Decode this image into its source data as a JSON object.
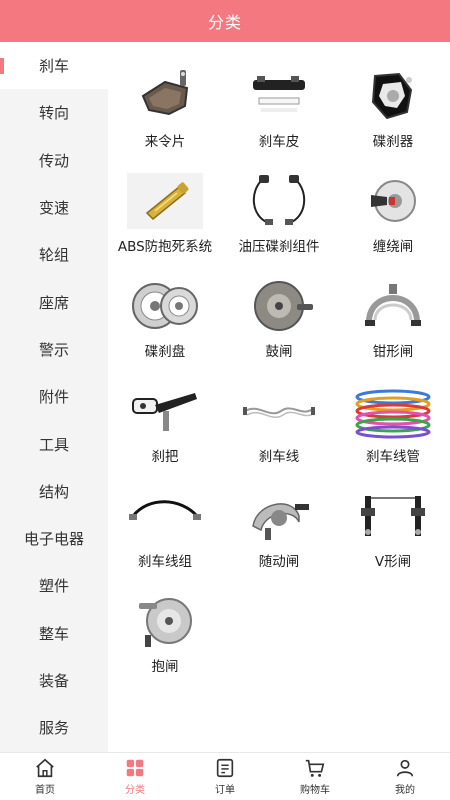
{
  "header": {
    "title": "分类"
  },
  "sidebar": {
    "items": [
      {
        "label": "刹车",
        "active": true
      },
      {
        "label": "转向"
      },
      {
        "label": "传动"
      },
      {
        "label": "变速"
      },
      {
        "label": "轮组"
      },
      {
        "label": "座席"
      },
      {
        "label": "警示"
      },
      {
        "label": "附件"
      },
      {
        "label": "工具"
      },
      {
        "label": "结构"
      },
      {
        "label": "电子电器"
      },
      {
        "label": "塑件"
      },
      {
        "label": "整车"
      },
      {
        "label": "装备"
      },
      {
        "label": "服务"
      }
    ]
  },
  "products": [
    {
      "label": "来令片",
      "icon": "brake-pad-icon"
    },
    {
      "label": "刹车皮",
      "icon": "brake-shoe-icon"
    },
    {
      "label": "碟刹器",
      "icon": "disc-caliper-icon"
    },
    {
      "label": "ABS防抱死系统",
      "icon": "abs-module-icon"
    },
    {
      "label": "油压碟刹组件",
      "icon": "hydraulic-disc-kit-icon"
    },
    {
      "label": "缠绕闸",
      "icon": "band-brake-icon"
    },
    {
      "label": "碟刹盘",
      "icon": "brake-rotor-icon"
    },
    {
      "label": "鼓闸",
      "icon": "drum-brake-icon"
    },
    {
      "label": "钳形闸",
      "icon": "caliper-brake-icon"
    },
    {
      "label": "刹把",
      "icon": "brake-lever-icon"
    },
    {
      "label": "刹车线",
      "icon": "brake-cable-icon"
    },
    {
      "label": "刹车线管",
      "icon": "cable-housing-icon"
    },
    {
      "label": "刹车线组",
      "icon": "cable-set-icon"
    },
    {
      "label": "随动闸",
      "icon": "follow-brake-icon"
    },
    {
      "label": "V形闸",
      "icon": "v-brake-icon"
    },
    {
      "label": "抱闸",
      "icon": "hub-brake-icon"
    }
  ],
  "tabbar": {
    "items": [
      {
        "label": "首页",
        "icon": "home-icon"
      },
      {
        "label": "分类",
        "icon": "category-icon",
        "active": true
      },
      {
        "label": "订单",
        "icon": "order-icon"
      },
      {
        "label": "购物车",
        "icon": "cart-icon"
      },
      {
        "label": "我的",
        "icon": "profile-icon"
      }
    ]
  },
  "colors": {
    "accent": "#f3787f",
    "sidebar_bg": "#f4f4f4"
  }
}
